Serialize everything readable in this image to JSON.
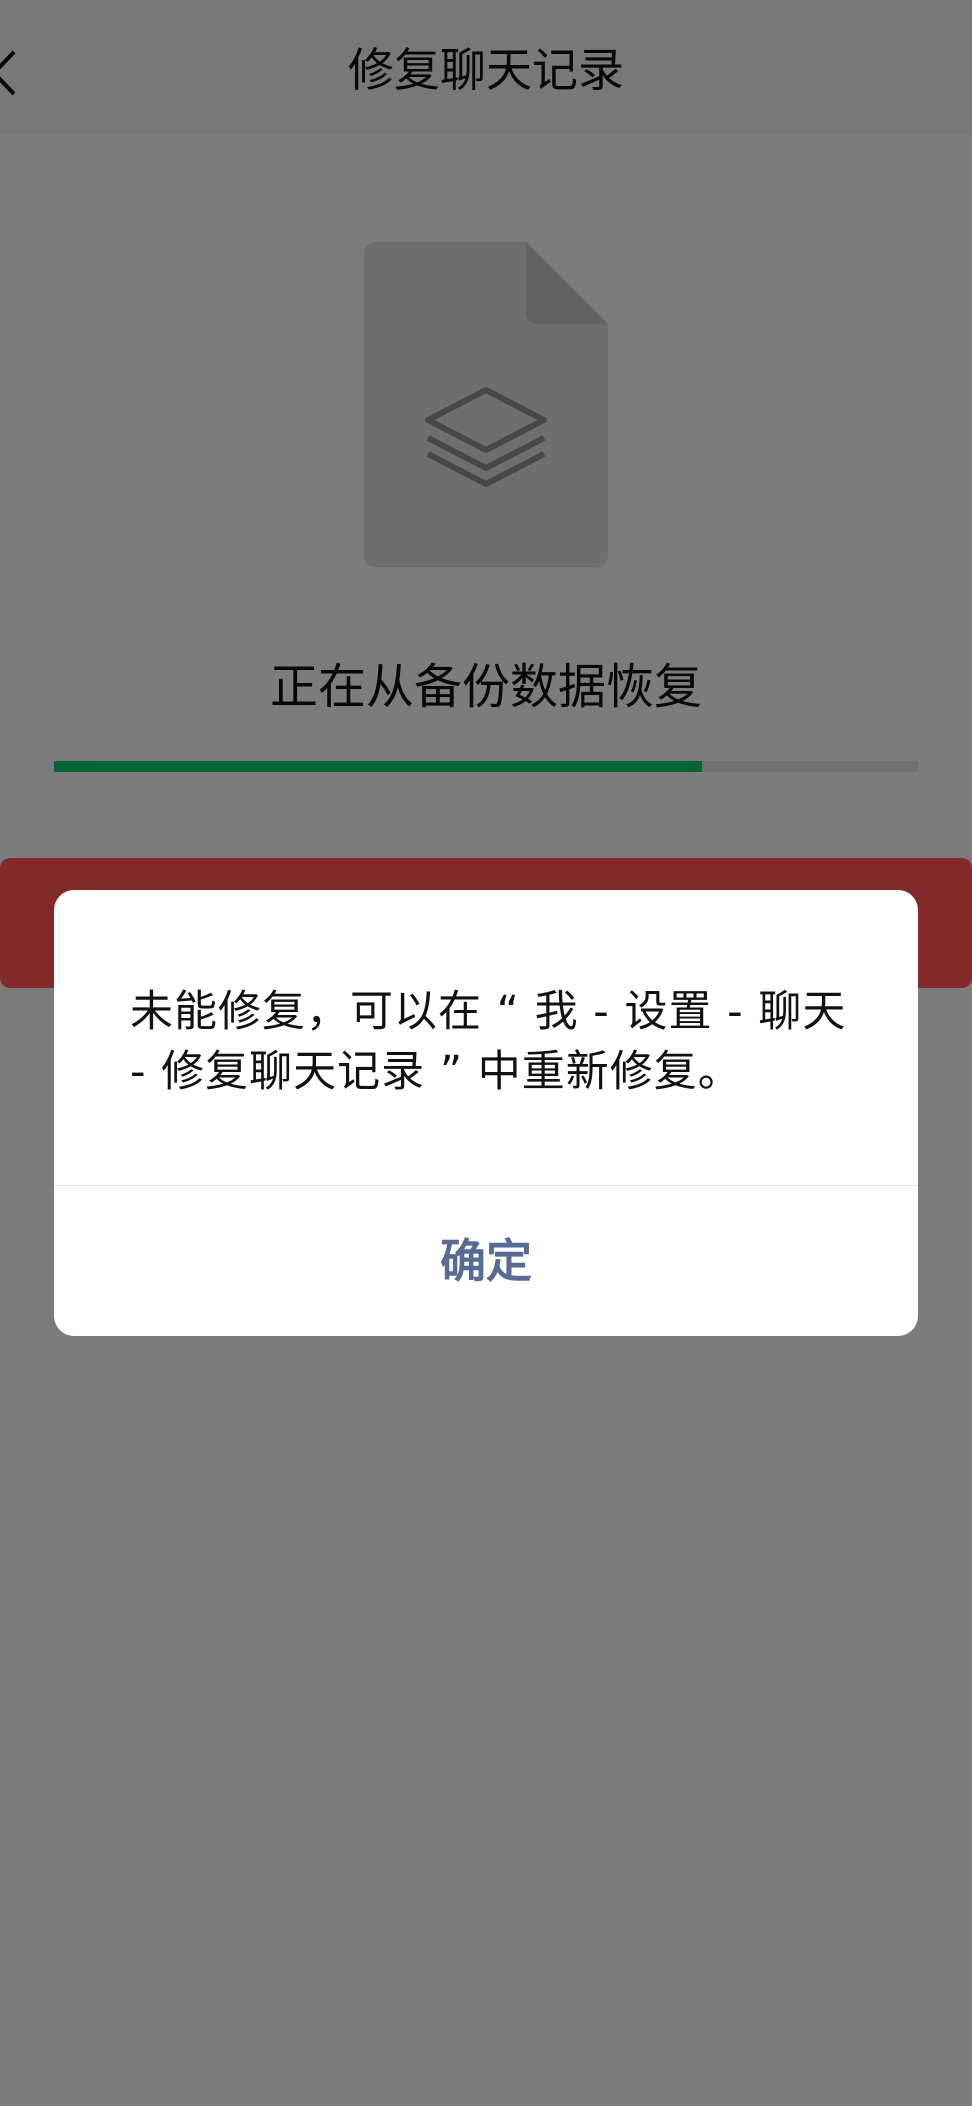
{
  "navbar": {
    "title": "修复聊天记录",
    "back_icon": "chevron-left-icon"
  },
  "main": {
    "illustration_icon": "stacked-layers-icon",
    "status_text": "正在从备份数据恢复",
    "progress_fraction": 0.75
  },
  "dialog": {
    "message": "未能修复，可以在 “ 我 - 设置 - 聊天 - 修复聊天记录 ” 中重新修复。",
    "confirm_label": "确定"
  },
  "colors": {
    "progress_fill": "#07c160",
    "progress_track": "#d9d9d9",
    "error_banner": "#fa5151",
    "dialog_button_text": "#576b95"
  }
}
